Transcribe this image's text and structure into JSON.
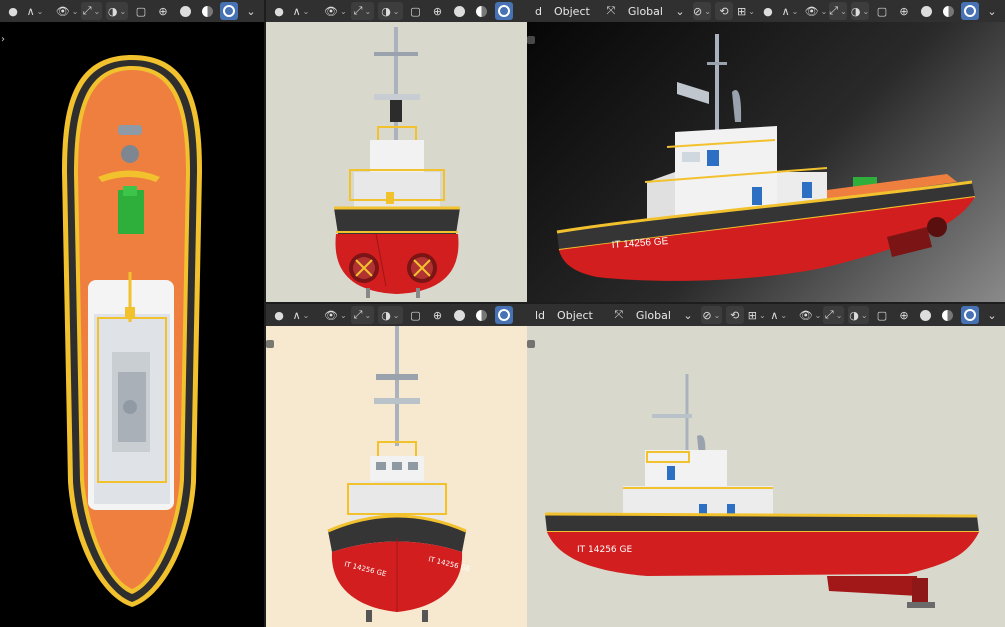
{
  "viewports": {
    "top_left": {
      "type": "Top Orthographic"
    },
    "top_mid": {
      "type": "Back Orthographic"
    },
    "top_right": {
      "mode_partial": "d",
      "mode": "Object",
      "transform": "Global",
      "hull_text": "IT 14256 GE"
    },
    "bottom_mid": {
      "type": "Front Orthographic",
      "hull_text_left": "IT 14256 GE",
      "hull_text_right": "IT 14256 GE"
    },
    "bottom_right": {
      "mode_partial": "ld",
      "mode": "Object",
      "transform": "Global",
      "hull_text": "IT 14256 GE"
    }
  },
  "icons": {
    "viewport_shading": [
      "wireframe-icon",
      "solid-icon",
      "material-icon",
      "rendered-icon"
    ],
    "header": [
      "view-icon",
      "curve-icon",
      "visibility-icon",
      "gizmo-icon",
      "overlay-icon",
      "xray-icon"
    ]
  },
  "colors": {
    "header_bg": "#303030",
    "active_blue": "#4772b3",
    "hull_red": "#d21e1e",
    "deck_orange": "#ef7f3f",
    "rail_yellow": "#f2c12e",
    "bg_gray": "#d9d8cc",
    "bg_cream": "#f6e9cf"
  }
}
